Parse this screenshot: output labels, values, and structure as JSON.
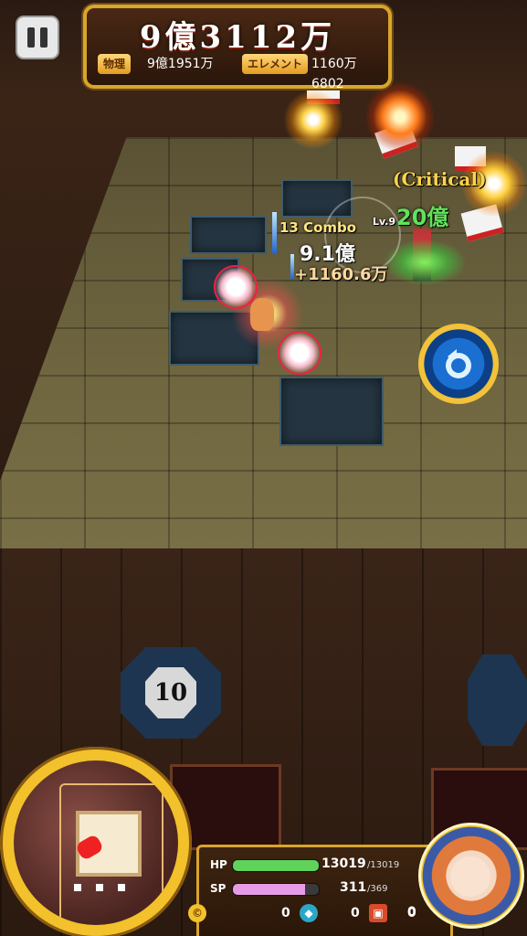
{
  "hud": {
    "score_total": "9億3112万",
    "physical_label": "物理",
    "physical_value": "9億1951万",
    "element_label": "エレメント",
    "element_value": "1160万6802"
  },
  "combat": {
    "critical": "Critical",
    "damage_crit": "20億",
    "combo": "13 Combo",
    "damage_main": "9.1億",
    "damage_bonus": "+1160.6万",
    "enemy_level": "Lv.9"
  },
  "tiles": {
    "number_tile_1": "10"
  },
  "status": {
    "hp_label": "HP",
    "hp_value": "13019",
    "hp_max": "/13019",
    "hp_fraction": 1.0,
    "sp_label": "SP",
    "sp_value": "311",
    "sp_max": "/369",
    "sp_fraction": 0.84,
    "coin_count": "0",
    "gem_count": "0",
    "chest_count": "0",
    "extra_count": "0"
  },
  "colors": {
    "gold": "#d9a52b",
    "hp": "#5fd35a",
    "sp": "#e79be6",
    "crit_green": "#5fe35a"
  }
}
